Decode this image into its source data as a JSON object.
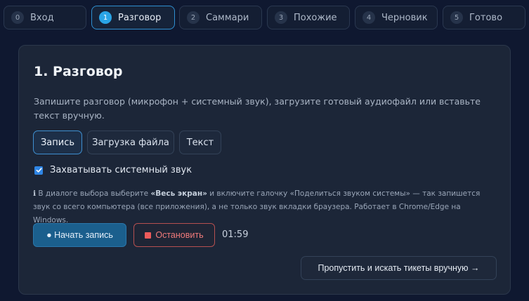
{
  "steps": [
    {
      "num": "0",
      "label": "Вход"
    },
    {
      "num": "1",
      "label": "Разговор"
    },
    {
      "num": "2",
      "label": "Саммари"
    },
    {
      "num": "3",
      "label": "Похожие"
    },
    {
      "num": "4",
      "label": "Черновик"
    },
    {
      "num": "5",
      "label": "Готово"
    }
  ],
  "active_step": 1,
  "card": {
    "title": "1. Разговор",
    "description": "Запишите разговор (микрофон + системный звук), загрузите готовый аудиофайл или вставьте текст вручную.",
    "tabs": [
      {
        "label": "Запись",
        "active": true
      },
      {
        "label": "Загрузка файла",
        "active": false
      },
      {
        "label": "Текст",
        "active": false
      }
    ],
    "checkbox": {
      "label": "Захватывать системный звук",
      "checked": true
    },
    "info": {
      "icon": "ℹ",
      "part1": "В диалоге выбора выберите ",
      "bold": "«Весь экран»",
      "part2": " и включите галочку «Поделиться звуком системы» — так запишется звук со всего компьютера (все приложения), а не только звук вкладки браузера. Работает в Chrome/Edge на Windows."
    },
    "record_button": "● Начать запись",
    "stop_button": "Остановить",
    "timer": "01:59",
    "skip_button": "Пропустить и искать тикеты вручную →"
  },
  "colors": {
    "background": "#0f1830",
    "card": "#1c2638",
    "accent": "#2aa4e6",
    "record": "#1b5f8d",
    "stop": "#ee5b5b"
  }
}
